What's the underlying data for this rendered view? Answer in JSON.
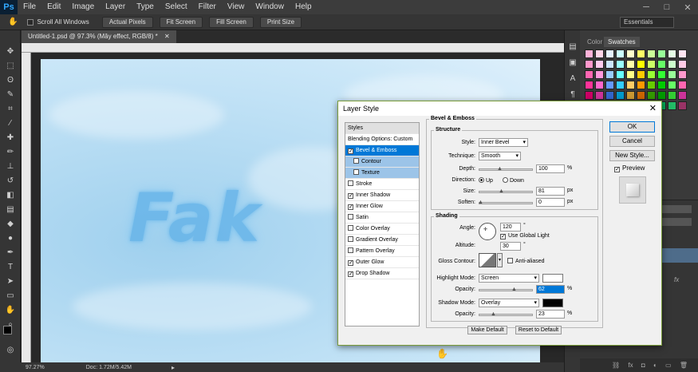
{
  "app": {
    "logo": "Ps"
  },
  "menu": [
    "File",
    "Edit",
    "Image",
    "Layer",
    "Type",
    "Select",
    "Filter",
    "View",
    "Window",
    "Help"
  ],
  "options_bar": {
    "scroll_all_windows": "Scroll All Windows",
    "actual_pixels": "Actual Pixels",
    "fit_screen": "Fit Screen",
    "fill_screen": "Fill Screen",
    "print_size": "Print Size",
    "workspace": "Essentials"
  },
  "document": {
    "tab_title": "Untitled-1.psd @ 97.3% (Mây effect, RGB/8) *",
    "canvas_text": "Fak"
  },
  "status": {
    "zoom": "97.27%",
    "doc": "Doc: 1.72M/5.42M"
  },
  "panels": {
    "tab_color": "Color",
    "tab_swatches": "Swatches"
  },
  "dialog": {
    "title": "Layer Style",
    "close": "✕",
    "styles_header": "Styles",
    "blending_options": "Blending Options: Custom",
    "style_items": [
      {
        "label": "Bevel & Emboss",
        "checked": true
      },
      {
        "label": "Contour",
        "checked": false
      },
      {
        "label": "Texture",
        "checked": false
      },
      {
        "label": "Stroke",
        "checked": false
      },
      {
        "label": "Inner Shadow",
        "checked": true
      },
      {
        "label": "Inner Glow",
        "checked": true
      },
      {
        "label": "Satin",
        "checked": false
      },
      {
        "label": "Color Overlay",
        "checked": false
      },
      {
        "label": "Gradient Overlay",
        "checked": false
      },
      {
        "label": "Pattern Overlay",
        "checked": false
      },
      {
        "label": "Outer Glow",
        "checked": true
      },
      {
        "label": "Drop Shadow",
        "checked": true
      }
    ],
    "section_title": "Bevel & Emboss",
    "structure": {
      "label": "Structure",
      "style_label": "Style:",
      "style_value": "Inner Bevel",
      "technique_label": "Technique:",
      "technique_value": "Smooth",
      "depth_label": "Depth:",
      "depth_value": "100",
      "depth_unit": "%",
      "direction_label": "Direction:",
      "dir_up": "Up",
      "dir_down": "Down",
      "size_label": "Size:",
      "size_value": "81",
      "size_unit": "px",
      "soften_label": "Soften:",
      "soften_value": "0",
      "soften_unit": "px"
    },
    "shading": {
      "label": "Shading",
      "angle_label": "Angle:",
      "angle_value": "120",
      "angle_unit": "°",
      "use_global_light": "Use Global Light",
      "altitude_label": "Altitude:",
      "altitude_value": "30",
      "altitude_unit": "°",
      "gloss_label": "Gloss Contour:",
      "anti_aliased": "Anti-aliased",
      "highlight_label": "Highlight Mode:",
      "highlight_value": "Screen",
      "h_opacity_label": "Opacity:",
      "h_opacity_value": "62",
      "h_opacity_unit": "%",
      "shadow_label": "Shadow Mode:",
      "shadow_value": "Overlay",
      "s_opacity_label": "Opacity:",
      "s_opacity_value": "23",
      "s_opacity_unit": "%"
    },
    "make_default": "Make Default",
    "reset_default": "Reset to Default",
    "ok": "OK",
    "cancel": "Cancel",
    "new_style": "New Style...",
    "preview": "Preview",
    "colors": {
      "highlight": "#ffffff",
      "shadow": "#000000"
    }
  }
}
